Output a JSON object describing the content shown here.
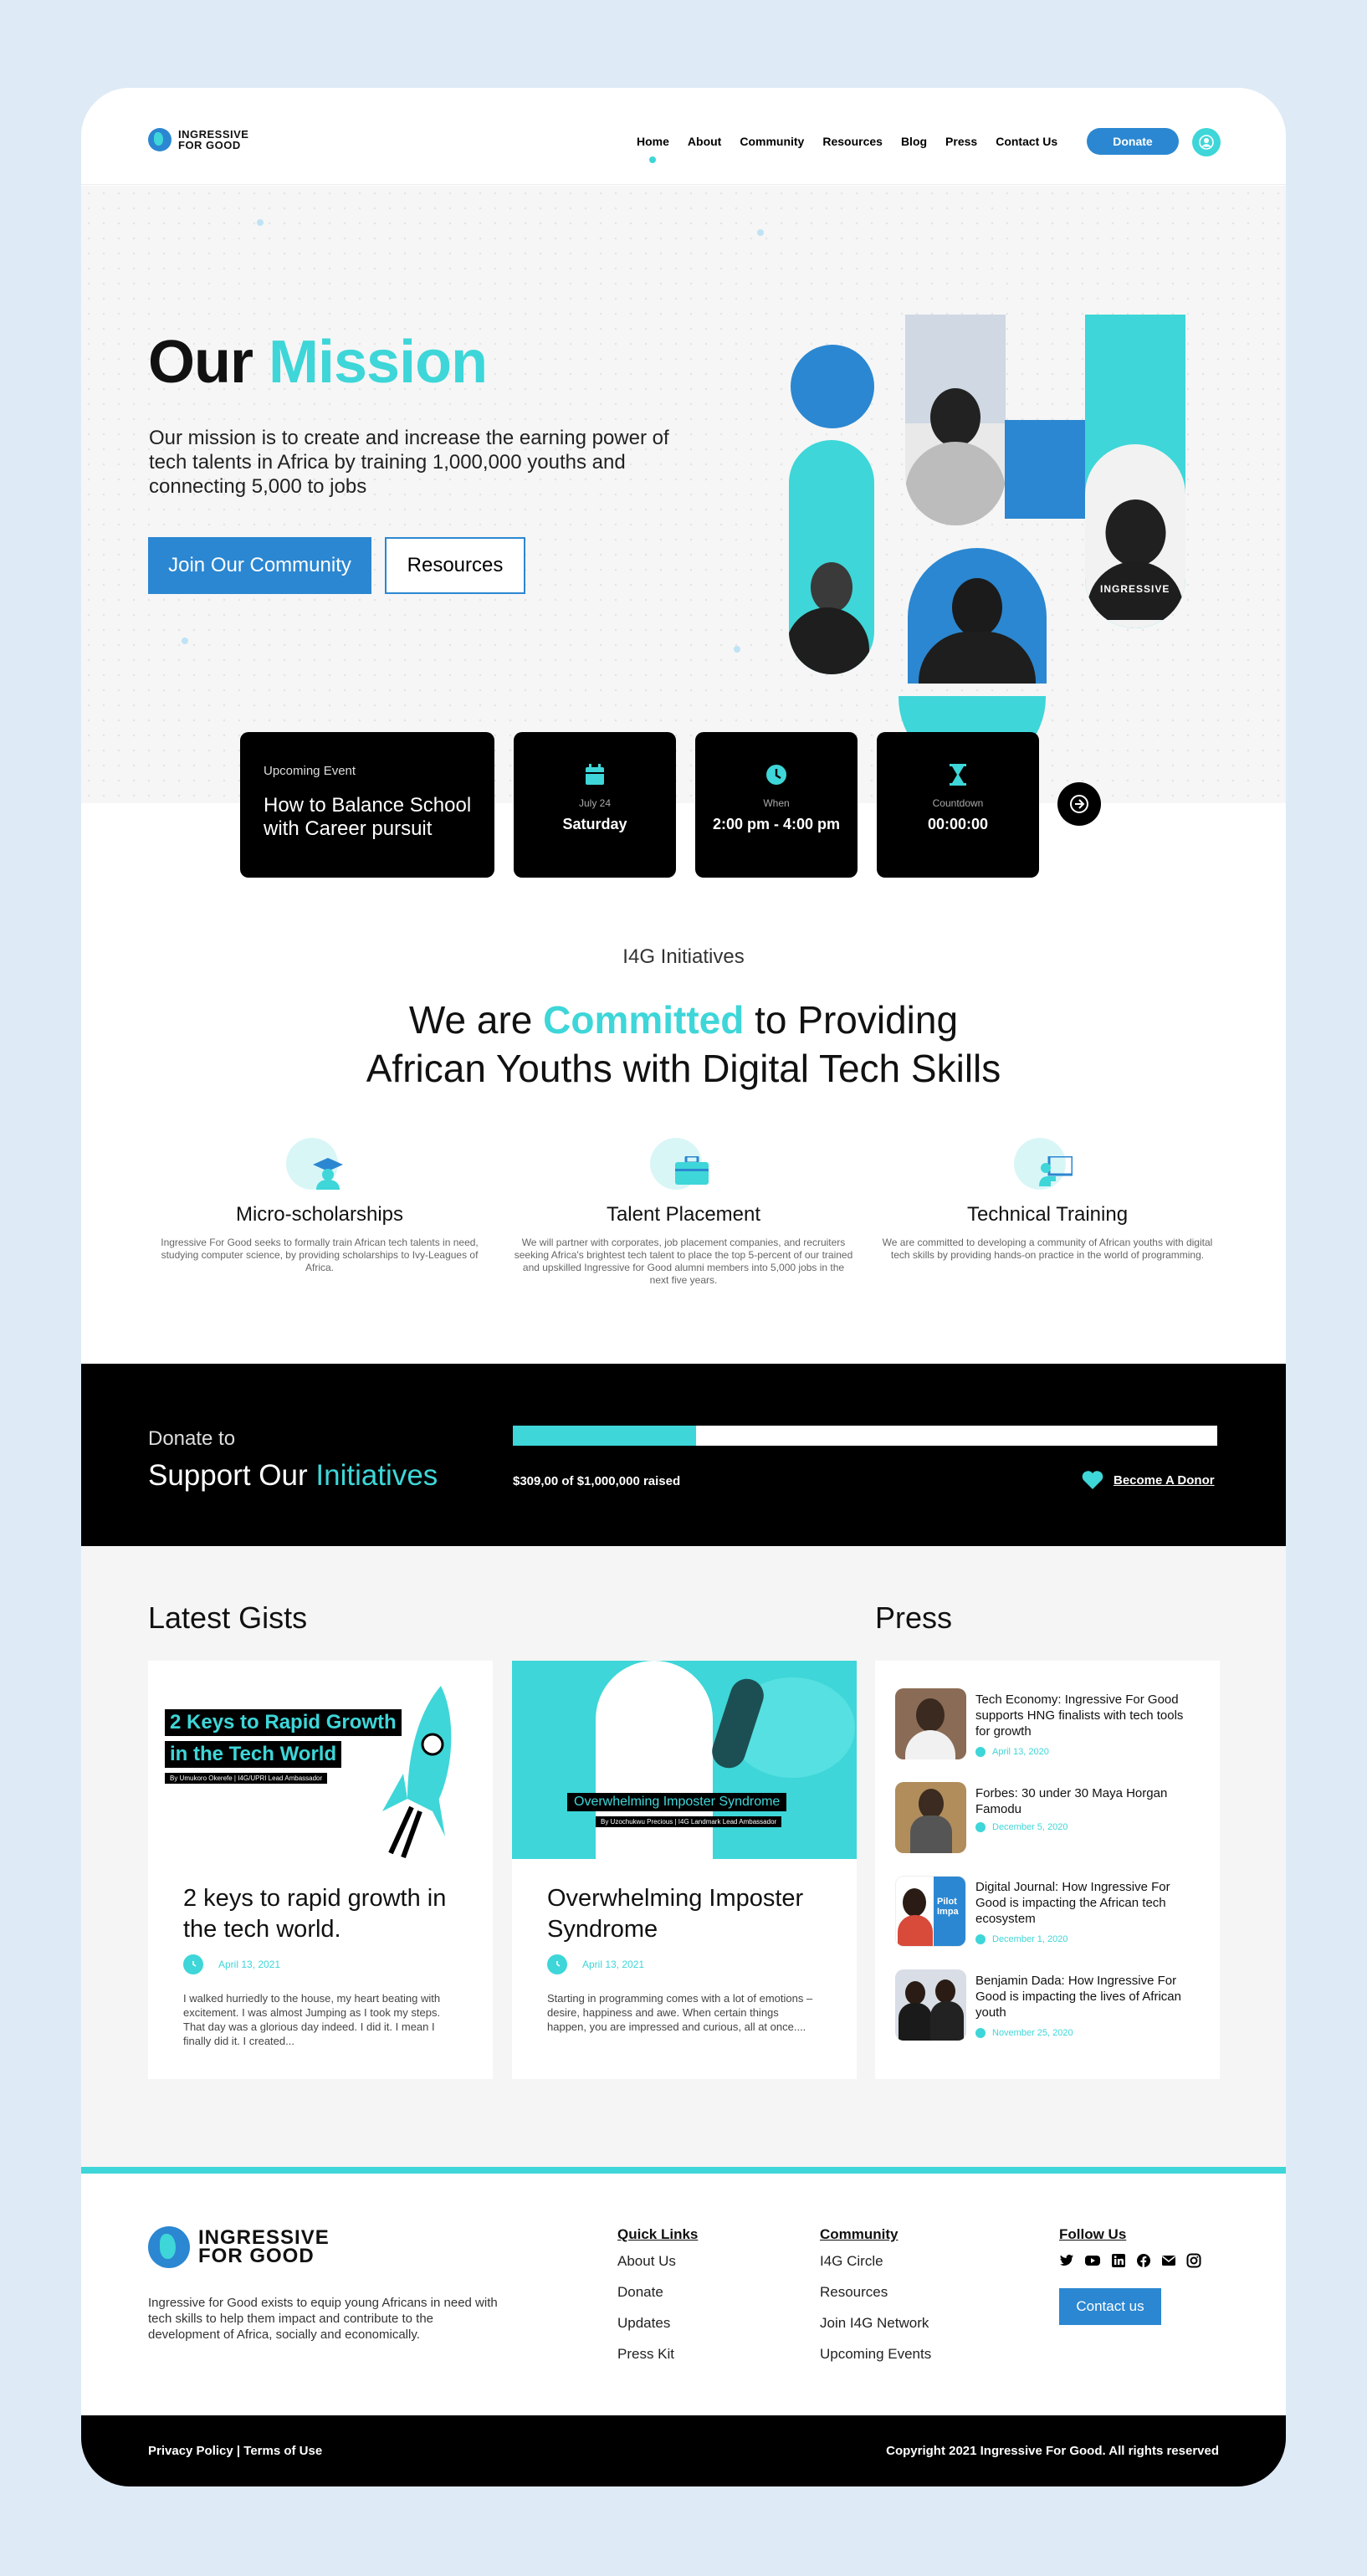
{
  "nav": {
    "logo_line1": "INGRESSIVE",
    "logo_line2": "FOR GOOD",
    "items": [
      "Home",
      "About",
      "Community",
      "Resources",
      "Blog",
      "Press",
      "Contact Us"
    ],
    "active": "Home",
    "donate_label": "Donate"
  },
  "hero": {
    "title_plain": "Our",
    "title_highlight": "Mission",
    "description": "Our mission is to create and increase the earning power of tech talents in Africa by training 1,000,000 youths and connecting 5,000 to jobs",
    "join_label": "Join Our Community",
    "resources_label": "Resources",
    "badge_text": "INGRESSIVE"
  },
  "event": {
    "tag": "Upcoming Event",
    "title": "How to Balance School with Career pursuit",
    "date_label": "July 24",
    "date_value": "Saturday",
    "when_label": "When",
    "when_value": "2:00 pm - 4:00 pm",
    "countdown_label": "Countdown",
    "countdown_value": "00:00:00"
  },
  "initiatives": {
    "tag": "I4G Initiatives",
    "heading_1": "We are",
    "heading_highlight": "Committed",
    "heading_2": "to Providing",
    "heading_line2": "African Youths with Digital Tech Skills",
    "items": [
      {
        "title": "Micro-scholarships",
        "icon": "graduate-icon",
        "text": "Ingressive For Good seeks to formally train African tech talents in need, studying computer science, by providing scholarships to Ivy-Leagues of Africa."
      },
      {
        "title": "Talent Placement",
        "icon": "briefcase-icon",
        "text": "We will partner with corporates, job placement companies, and recruiters seeking Africa's brightest tech talent to place the top 5-percent of our trained and upskilled Ingressive for Good alumni members into 5,000 jobs in the next five years."
      },
      {
        "title": "Technical Training",
        "icon": "teacher-icon",
        "text": "We are committed to developing a community of African youths with digital tech skills by providing hands-on practice in the world of programming."
      }
    ]
  },
  "donate": {
    "line1": "Donate to",
    "line2_plain": "Support Our",
    "line2_highlight": "Initiatives",
    "progress": 0.26,
    "raised_text": "$309,00 of $1,000,000 raised",
    "become_label": "Become A Donor"
  },
  "gists": {
    "heading": "Latest Gists",
    "cards": [
      {
        "image_title_1": "2 Keys to Rapid Growth",
        "image_title_2": "in the Tech World",
        "image_byline": "By Umukoro Okerefe | I4G/UPRI Lead Ambassador",
        "title": "2 keys to rapid growth in the tech world.",
        "date": "April 13, 2021",
        "excerpt": "I walked hurriedly to the house, my heart beating with excitement. I was almost Jumping as I took my steps. That day was a glorious day indeed. I did it. I mean I finally did it. I created..."
      },
      {
        "image_title_1": "Overwhelming Imposter Syndrome",
        "image_byline": "By Uzochukwu Precious | I4G Landmark Lead Ambassador",
        "title": "Overwhelming Imposter Syndrome",
        "date": "April 13, 2021",
        "excerpt": "Starting in programming comes with a lot of emotions – desire, happiness and awe.  When certain things happen, you are impressed and curious, all at once...."
      }
    ]
  },
  "press": {
    "heading": "Press",
    "items": [
      {
        "title": "Tech Economy: Ingressive For Good supports HNG finalists with tech tools for growth",
        "date": "April 13, 2020"
      },
      {
        "title": "Forbes: 30 under 30 Maya Horgan Famodu",
        "date": "December 5, 2020"
      },
      {
        "title": "Digital Journal: How Ingressive For Good is impacting the African tech ecosystem",
        "date": "December 1, 2020"
      },
      {
        "title": "Benjamin Dada: How Ingressive For Good is impacting the lives of African youth",
        "date": "November 25, 2020"
      }
    ],
    "thumb_text": "Pilot Impa"
  },
  "footer": {
    "logo_line1": "INGRESSIVE",
    "logo_line2": "FOR GOOD",
    "description": "Ingressive for Good exists to equip young Africans in need with tech skills to help them impact and contribute to the development of Africa, socially and economically.",
    "quick_links_title": "Quick Links",
    "quick_links": [
      "About Us",
      "Donate",
      "Updates",
      "Press Kit"
    ],
    "community_title": "Community",
    "community_links": [
      "I4G Circle",
      "Resources",
      "Join I4G Network",
      "Upcoming Events"
    ],
    "follow_title": "Follow Us",
    "social_icons": [
      "twitter-icon",
      "youtube-icon",
      "linkedin-icon",
      "facebook-icon",
      "mail-icon",
      "instagram-icon"
    ],
    "contact_label": "Contact us",
    "legal": "Privacy Policy | Terms of Use",
    "copyright": "Copyright 2021 Ingressive For Good. All rights reserved"
  },
  "colors": {
    "accent": "#3ed6d8",
    "primary": "#2b87d1",
    "dark": "#000000"
  }
}
